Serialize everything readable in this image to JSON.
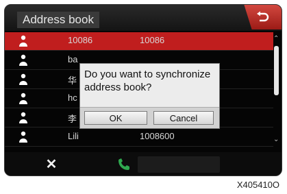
{
  "header": {
    "title": "Address book",
    "back_icon": "back-arrow-icon"
  },
  "contacts": [
    {
      "name": "10086",
      "number": "10086",
      "selected": true
    },
    {
      "name": "ba",
      "number": ""
    },
    {
      "name": "华",
      "number": ""
    },
    {
      "name": "hc",
      "number": ""
    },
    {
      "name": "李",
      "number": ""
    },
    {
      "name": "Lili",
      "number": "1008600"
    }
  ],
  "dialog": {
    "message": "Do you want to synchronize address book?",
    "ok_label": "OK",
    "cancel_label": "Cancel"
  },
  "footer": {
    "close_icon": "close-icon",
    "call_icon": "phone-icon"
  },
  "caption": "X405410O",
  "colors": {
    "accent": "#c01e1e",
    "call": "#2fa84f"
  }
}
